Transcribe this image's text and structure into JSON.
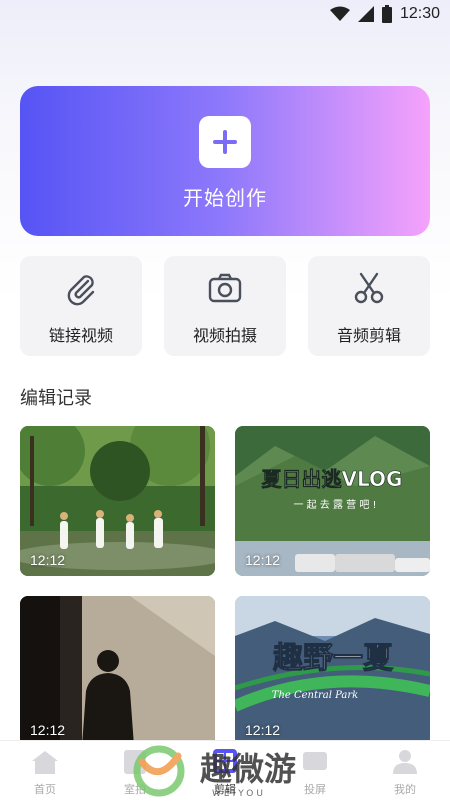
{
  "status_bar": {
    "time": "12:30"
  },
  "hero": {
    "label": "开始创作"
  },
  "quick_actions": [
    {
      "label": "链接视频",
      "icon": "paperclip-icon"
    },
    {
      "label": "视频拍摄",
      "icon": "camera-icon"
    },
    {
      "label": "音频剪辑",
      "icon": "scissors-icon"
    }
  ],
  "section": {
    "title": "编辑记录"
  },
  "records": [
    {
      "duration": "12:12"
    },
    {
      "duration": "12:12",
      "overlay_title": "夏日出逃VLOG",
      "overlay_subtitle": "一 起 去 露 营 吧 !"
    },
    {
      "duration": "12:12"
    },
    {
      "duration": "12:12",
      "overlay_title": "趣野一夏",
      "overlay_subtitle": "The Central Park"
    }
  ],
  "tabbar": {
    "tabs": [
      {
        "label": "首页"
      },
      {
        "label": "室拍"
      },
      {
        "label": "剪辑"
      },
      {
        "label": "投屏"
      },
      {
        "label": "我的"
      }
    ],
    "active": "剪辑"
  },
  "watermark": {
    "text": "趣微游",
    "sub": "WEIYOU"
  },
  "colors": {
    "accent_start": "#5654f5",
    "accent_end": "#f5a2fb"
  }
}
